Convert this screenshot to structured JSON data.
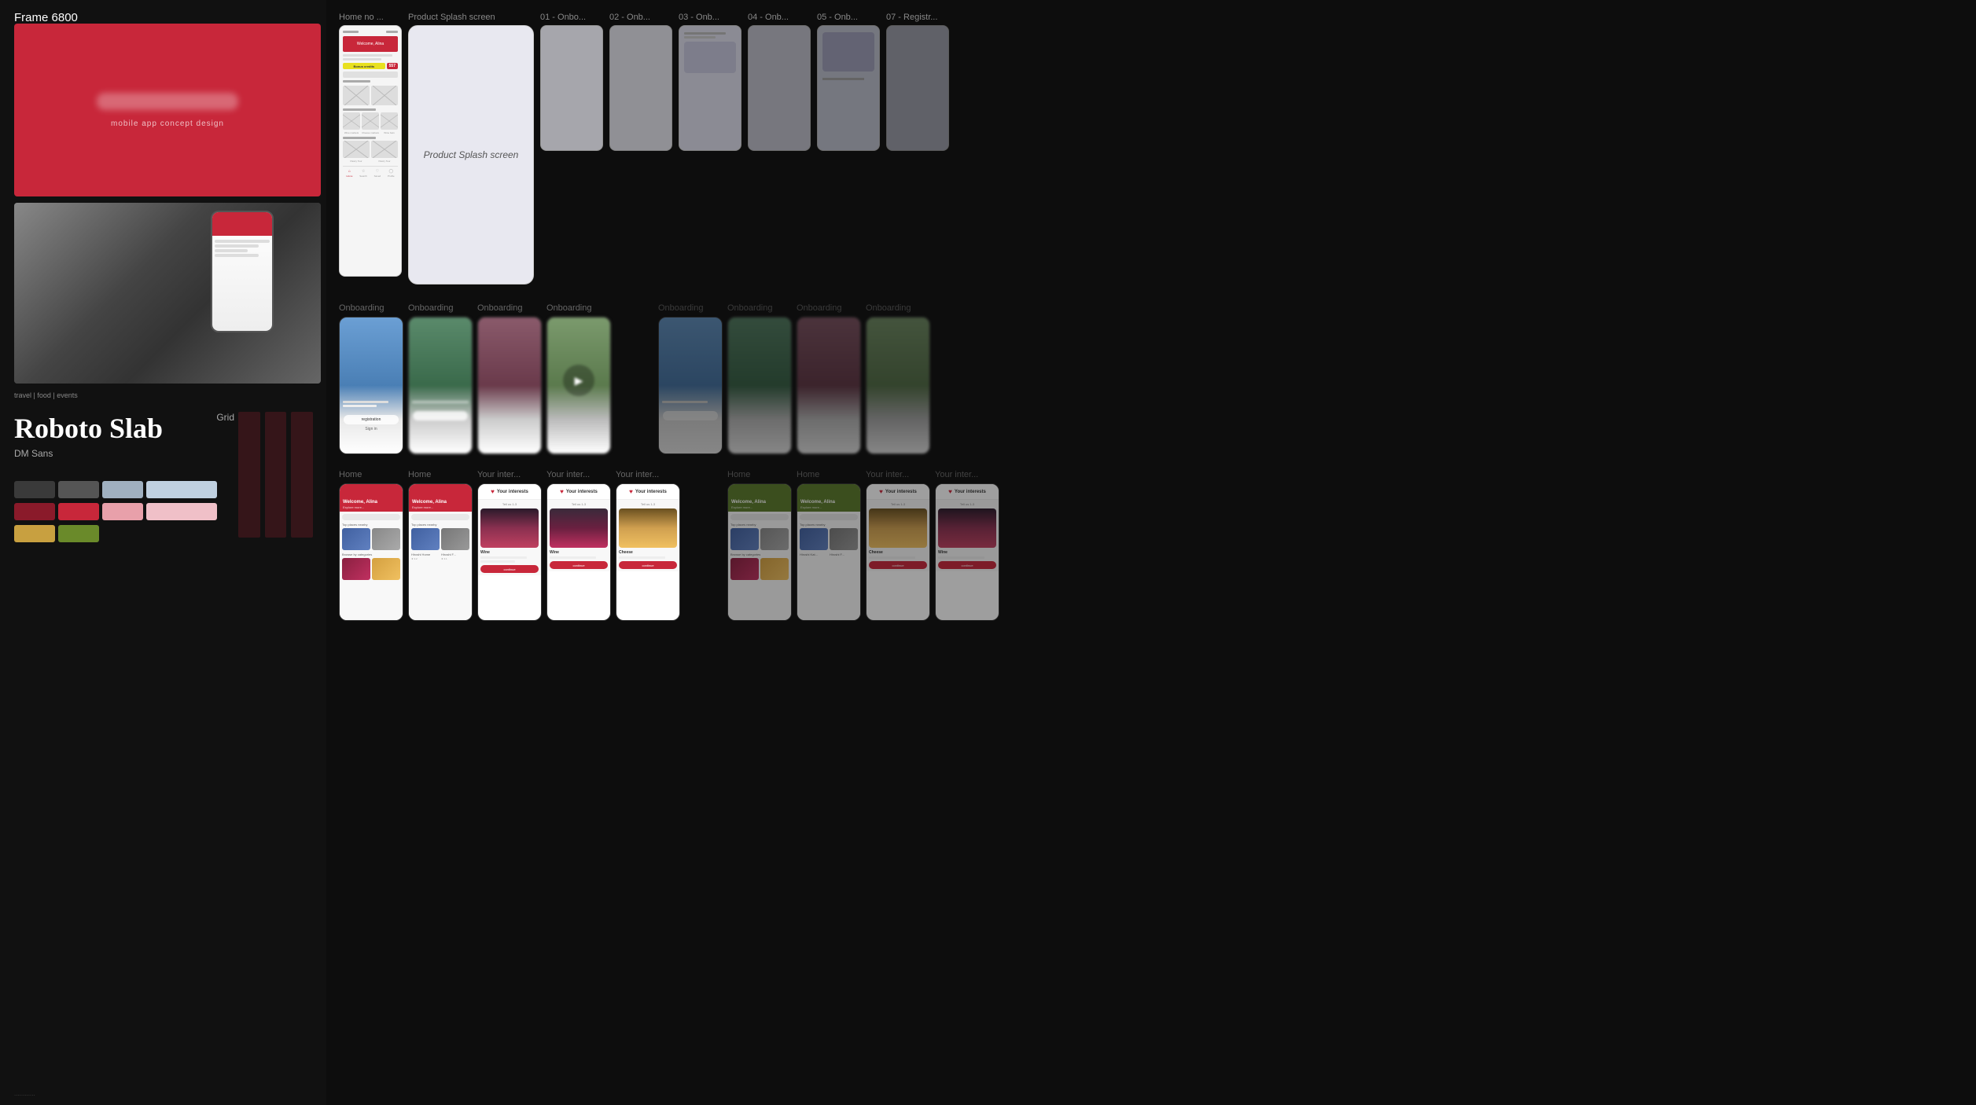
{
  "left_panel": {
    "title": "Frame 6800",
    "hero_sub": "mobile app concept design",
    "font_name": "Roboto Slab",
    "font_sub": "DM Sans",
    "grid_label": "Grid",
    "style_tags": "travel | food | events"
  },
  "top_row": {
    "frames": [
      {
        "label": "Home no ...",
        "type": "wireframe"
      },
      {
        "label": "Product Splash screen",
        "type": "splash"
      },
      {
        "label": "01 - Onbo...",
        "type": "onboarding"
      },
      {
        "label": "02 - Onb...",
        "type": "onboarding"
      },
      {
        "label": "03 - Onb...",
        "type": "onboarding"
      },
      {
        "label": "04 - Onb...",
        "type": "onboarding"
      },
      {
        "label": "05 - Onb...",
        "type": "onboarding"
      },
      {
        "label": "07 - Registr...",
        "type": "onboarding"
      }
    ]
  },
  "mid_row": {
    "left_group": {
      "label": "Onboarding",
      "screens": [
        "Onboarding",
        "Onboarding",
        "Onboarding",
        "Onboarding"
      ]
    },
    "right_group": {
      "screens": [
        "Onboarding",
        "Onboarding",
        "Onboarding",
        "Onboarding"
      ]
    }
  },
  "bottom_row": {
    "left_group": {
      "screens": [
        {
          "type": "home",
          "label": "Home",
          "header_text": "Welcome, Alina"
        },
        {
          "type": "home",
          "label": "Home",
          "header_text": "Welcome, Alina"
        },
        {
          "type": "interests",
          "label": "Your inter...",
          "category": "Wine"
        },
        {
          "type": "interests",
          "label": "Your inter...",
          "category": "Wine"
        },
        {
          "type": "interests",
          "label": "Your inter...",
          "category": "Cheese"
        }
      ]
    },
    "right_group": {
      "screens": [
        {
          "type": "home",
          "label": "Home",
          "header_text": "Welcome, Alina"
        },
        {
          "type": "home",
          "label": "Home",
          "header_text": "Welcome, Alina"
        },
        {
          "type": "interests",
          "label": "Your inter...",
          "category": "Cheese"
        },
        {
          "type": "interests",
          "label": "Your inter...",
          "category": "Wine"
        }
      ]
    }
  },
  "footer_labels": {
    "your_interests_1": "Your interests",
    "your_interests_2": "Your interests"
  },
  "colors": {
    "dark1": "#3a3a3a",
    "dark2": "#555555",
    "light1": "#aabbcc",
    "accent_red": "#c8273a",
    "accent_red_light": "#e8a0aa",
    "accent_pink": "#f0c0c8",
    "gold": "#c8a040",
    "green": "#6a8a2a"
  }
}
